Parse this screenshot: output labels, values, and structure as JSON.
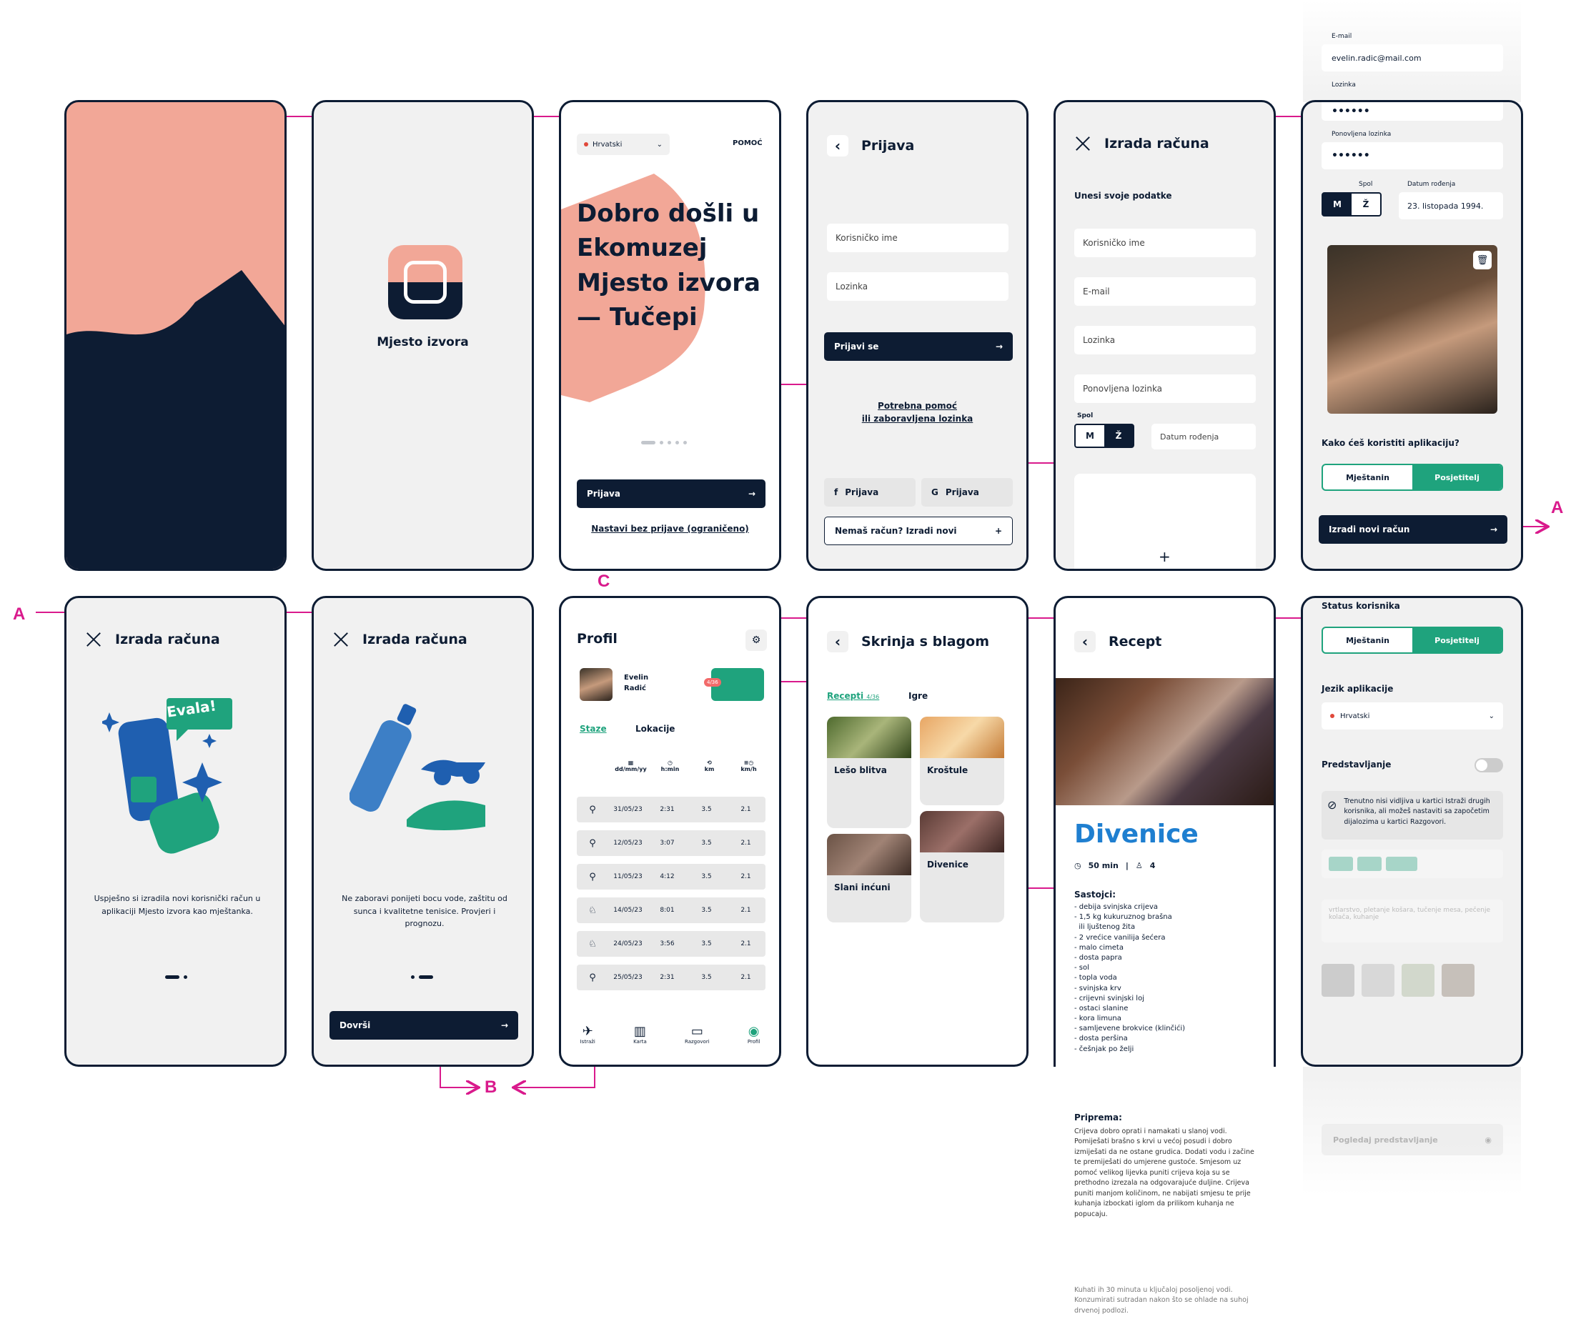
{
  "screen1": {
    "name": "splash"
  },
  "screen2": {
    "app_name": "Mjesto izvora"
  },
  "screen3": {
    "lang": "Hrvatski",
    "help": "POMOĆ",
    "title": "Dobro došli u Ekomuzej Mjesto izvora — Tučepi",
    "login": "Prijava",
    "continue": "Nastavi bez prijave (ograničeno)"
  },
  "screen4": {
    "title": "Prijava",
    "username": "Korisničko ime",
    "password": "Lozinka",
    "login_btn": "Prijavi se",
    "help_line1": "Potrebna pomoć",
    "help_line2": "ili zaboravljena lozinka",
    "fb": "Prijava",
    "google": "Prijava",
    "create": "Nemaš račun? Izradi novi"
  },
  "screen5": {
    "title": "Izrada računa",
    "subtitle": "Unesi svoje podatke",
    "username": "Korisničko ime",
    "email": "E-mail",
    "password": "Lozinka",
    "password2": "Ponovljena lozinka",
    "gender_label": "Spol",
    "m": "M",
    "z": "Ž",
    "dob": "Datum rođenja"
  },
  "screen6": {
    "email_label": "E-mail",
    "email": "evelin.radic@mail.com",
    "pw_label": "Lozinka",
    "pw": "••••••",
    "pw2_label": "Ponovljena lozinka",
    "pw2": "••••••",
    "gender_label": "Spol",
    "m": "M",
    "z": "Ž",
    "dob_label": "Datum rođenja",
    "dob": "23. listopada 1994.",
    "question": "Kako ćeš koristiti aplikaciju?",
    "opt1": "Mještanin",
    "opt2": "Posjetitelj",
    "create_btn": "Izradi novi račun"
  },
  "screen7": {
    "title": "Izrada računa",
    "badge": "Evala!",
    "text": "Uspješno si izradila novi korisnički račun u aplikaciji Mjesto izvora kao mještanka."
  },
  "screen8": {
    "title": "Izrada računa",
    "text": "Ne zaboravi ponijeti bocu vode, zaštitu od sunca i kvalitetne tenisice. Provjeri i prognozu.",
    "btn": "Dovrši"
  },
  "screen9": {
    "title": "Profil",
    "user": "Evelin Radić",
    "tabs": [
      "Staze",
      "Lokacije"
    ],
    "cols": [
      "dd/mm/yy",
      "h:min",
      "km",
      "km/h"
    ],
    "rows": [
      [
        "31/05/23",
        "2:31",
        "3.5",
        "2.1"
      ],
      [
        "12/05/23",
        "3:07",
        "3.5",
        "2.1"
      ],
      [
        "11/05/23",
        "4:12",
        "3.5",
        "2.1"
      ],
      [
        "14/05/23",
        "8:01",
        "3.5",
        "2.1"
      ],
      [
        "24/05/23",
        "3:56",
        "3.5",
        "2.1"
      ],
      [
        "25/05/23",
        "2:31",
        "3.5",
        "2.1"
      ]
    ],
    "nav": [
      "Istraži",
      "Karta",
      "Razgovori",
      "Profil"
    ]
  },
  "screen10": {
    "title": "Skrinja s blagom",
    "tab1": "Recepti",
    "tab1_count": "4/36",
    "tab2": "Igre",
    "cards": [
      "Lešo blitva",
      "Kroštule",
      "Slani inćuni",
      "Divenice"
    ]
  },
  "screen11": {
    "title": "Recept",
    "recipe": "Divenice",
    "time": "50 min",
    "serves": "4",
    "ingredients_title": "Sastojci:",
    "ingredients": [
      "- debija svinjska crijeva",
      "- 1,5 kg kukuruznog brašna",
      "  ili ljuštenog žita",
      "- 2 vrećice vanilija šećera",
      "- malo cimeta",
      "- dosta papra",
      "- sol",
      "- topla voda",
      "- svinjska krv",
      "- crijevni svinjski loj",
      "- ostaci slanine",
      "- kora limuna",
      "- samljevene brokvice (klinčići)",
      "- dosta peršina",
      "- češnjak po želji"
    ],
    "prep_title": "Priprema:",
    "prep": "Crijeva dobro oprati i namakati u slanoj vodi. Pomiješati brašno s krvi u većoj posudi i dobro izmiješati da ne ostane grudica. Dodati vodu i začine te premiješati do umjerene gustoće. Smjesom uz pomoć velikog lijevka puniti crijeva koja su se prethodno izrezala na odgovarajuće duljine. Crijeva puniti manjom količinom, ne nabijati smjesu te prije kuhanja izbockati iglom da prilikom kuhanja ne popucaju.",
    "prep2": "Kuhati ih 30 minuta u ključaloj posoljenoj vodi. Konzumirati sutradan nakon što se ohlade na suhoj drvenoj podlozi."
  },
  "screen12": {
    "status": "Status korisnika",
    "opt1": "Mještanin",
    "opt2": "Posjetitelj",
    "lang_label": "Jezik aplikacije",
    "lang": "Hrvatski",
    "intro": "Predstavljanje",
    "note": "Trenutno nisi vidljiva u kartici Istraži drugih korisnika, ali možeš nastaviti sa započetim dijalozima u kartici Razgovori.",
    "interests": "vrtlarstvo, pletanje košara, tučenje mesa, pečenje kolača, kuhanje",
    "preview": "Pogledaj predstavljanje"
  },
  "labels": {
    "a": "A",
    "b": "B",
    "c": "C"
  },
  "colors": {
    "navy": "#0d1c33",
    "salmon": "#f2a797",
    "green": "#1fa37d",
    "magenta": "#d91a8c"
  }
}
